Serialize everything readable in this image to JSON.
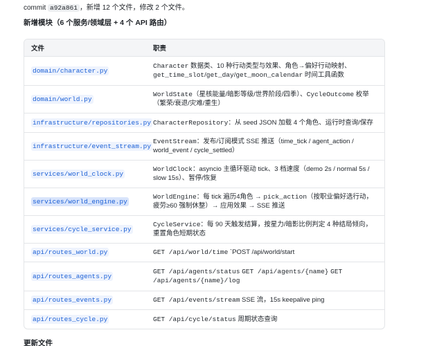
{
  "intro": {
    "prefix": "commit",
    "hash": "a92a861",
    "suffix": "，新增 12 个文件，修改 2 个文件。"
  },
  "section_title": "新增模块（6 个服务/领域层 + 4 个 API 路由）",
  "table": {
    "headers": [
      "文件",
      "职责"
    ],
    "rows": [
      {
        "file": "domain/character.py",
        "desc": [
          [
            "code",
            "Character"
          ],
          [
            "text",
            " 数据类、10 种行动类型与效果、角色→偏好行动映射、"
          ],
          [
            "code",
            "get_time_slot"
          ],
          [
            "text",
            "/"
          ],
          [
            "code",
            "get_day"
          ],
          [
            "text",
            "/"
          ],
          [
            "code",
            "get_moon_calendar"
          ],
          [
            "text",
            " 时间工具函数"
          ]
        ]
      },
      {
        "file": "domain/world.py",
        "desc": [
          [
            "code",
            "WorldState"
          ],
          [
            "text",
            "（星核能量/暗影等级/世界阶段/四季）、"
          ],
          [
            "code",
            "CycleOutcome"
          ],
          [
            "text",
            " 枚举（繁荣/衰退/灾难/重生）"
          ]
        ]
      },
      {
        "file": "infrastructure/repositories.py",
        "desc": [
          [
            "code",
            "CharacterRepository"
          ],
          [
            "text",
            "：从 seed JSON 加载 4 个角色、运行时查询/保存"
          ]
        ]
      },
      {
        "file": "infrastructure/event_stream.py",
        "desc": [
          [
            "code",
            "EventStream"
          ],
          [
            "text",
            "：发布/订阅模式 SSE 推送（time_tick / agent_action / world_event / cycle_settled）"
          ]
        ]
      },
      {
        "file": "services/world_clock.py",
        "desc": [
          [
            "code",
            "WorldClock"
          ],
          [
            "text",
            "：asyncio 主循环驱动 tick、3 档速度（demo 2s / normal 5s / slow 15s）、暂停/恢复"
          ]
        ]
      },
      {
        "file": "services/world_engine.py",
        "selected": true,
        "desc": [
          [
            "code",
            "WorldEngine"
          ],
          [
            "text",
            "：每 tick 遍历4角色 → "
          ],
          [
            "code",
            "pick_action"
          ],
          [
            "text",
            "（按职业偏好选行动，疲劳≥60 强制休整）→ 应用效果 → SSE 推送"
          ]
        ]
      },
      {
        "file": "services/cycle_service.py",
        "desc": [
          [
            "code",
            "CycleService"
          ],
          [
            "text",
            "：每 90 天触发结算，按星力/暗影比例判定 4 种结局倾向，重置角色短期状态"
          ]
        ]
      },
      {
        "file": "api/routes_world.py",
        "desc": [
          [
            "code",
            "GET /api/world/time"
          ],
          [
            "text",
            " `POST /api/world/start"
          ]
        ]
      },
      {
        "file": "api/routes_agents.py",
        "desc": [
          [
            "code",
            "GET /api/agents/status"
          ],
          [
            "text",
            " "
          ],
          [
            "code",
            "GET /api/agents/{name}"
          ],
          [
            "text",
            " "
          ],
          [
            "code",
            "GET /api/agents/{name}/log"
          ]
        ]
      },
      {
        "file": "api/routes_events.py",
        "desc": [
          [
            "code",
            "GET /api/events/stream"
          ],
          [
            "text",
            " SSE 流，15s keepalive ping"
          ]
        ]
      },
      {
        "file": "api/routes_cycle.py",
        "desc": [
          [
            "code",
            "GET /api/cycle/status"
          ],
          [
            "text",
            " 周期状态查询"
          ]
        ]
      }
    ]
  },
  "footer_title": "更新文件"
}
